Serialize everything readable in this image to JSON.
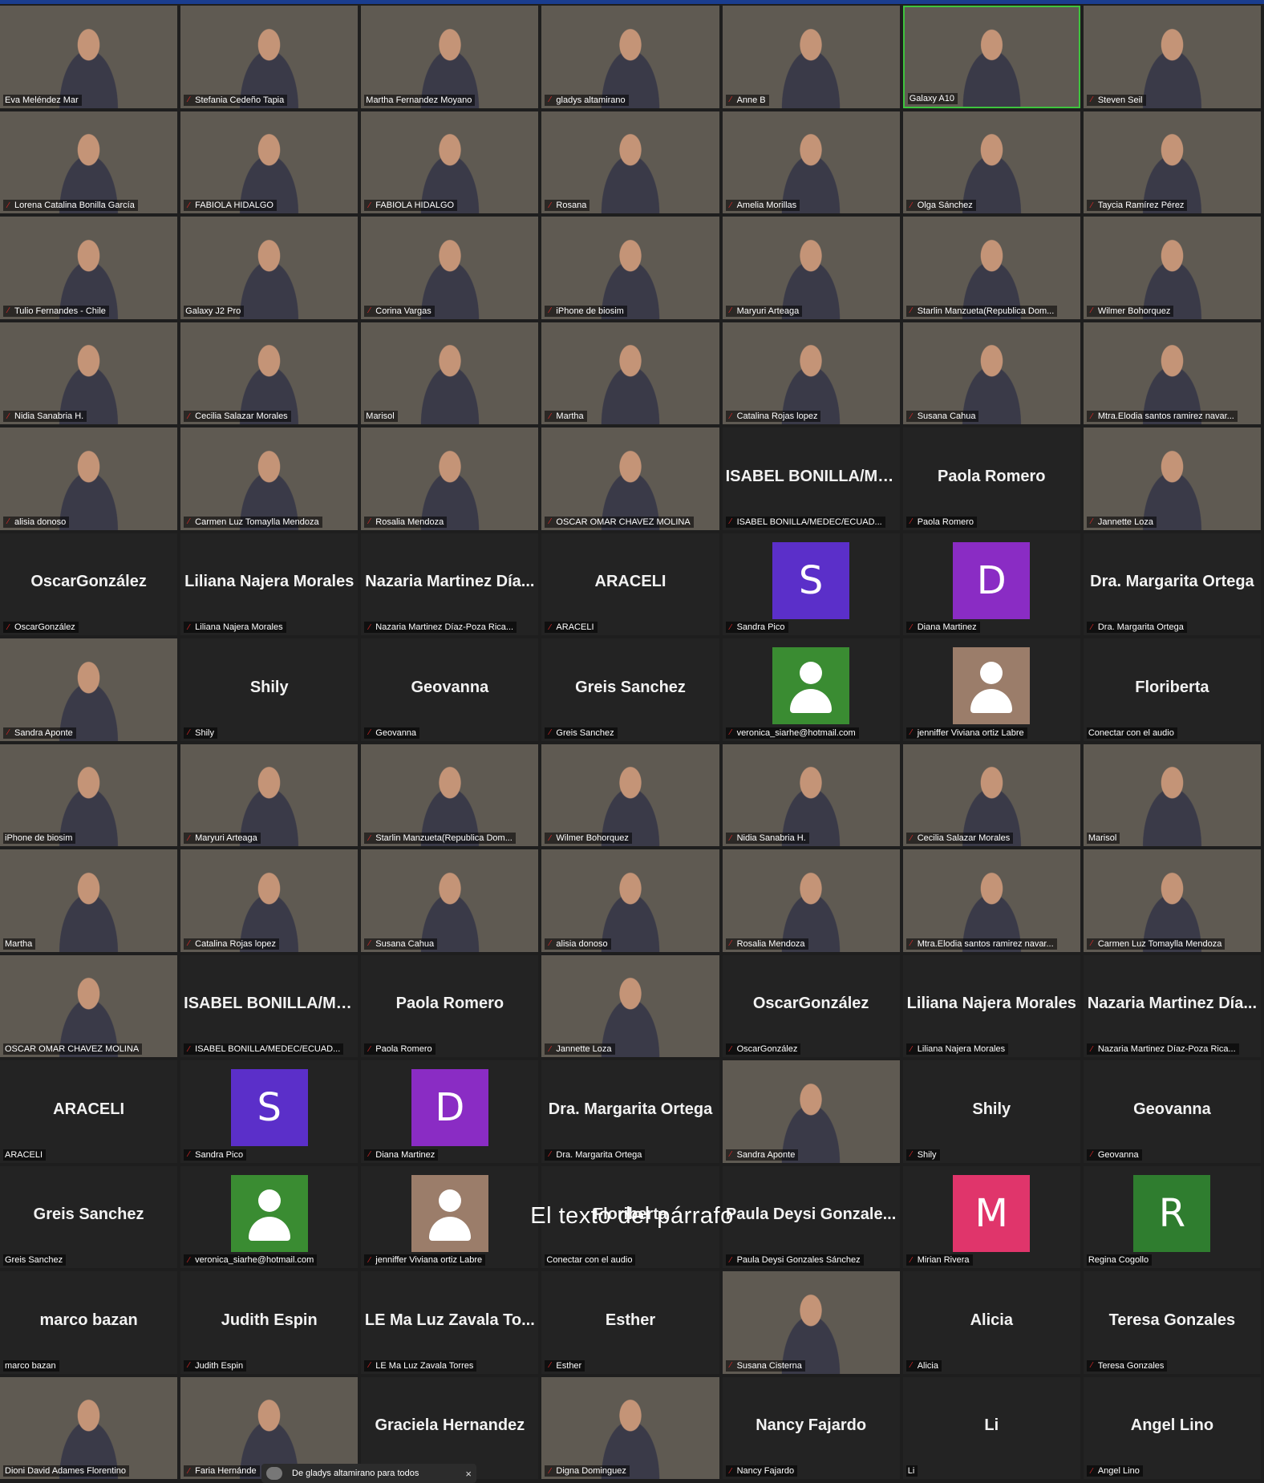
{
  "overlay_text": "El texto del párrafo",
  "chat_toast": {
    "text": "De gladys altamirano para todos",
    "close": "×"
  },
  "colors": {
    "active_speaker_border": "#3ec43e",
    "muted_mic": "#e02828"
  },
  "participants": [
    {
      "label": "Eva Meléndez Mar",
      "video": true
    },
    {
      "label": "Stefania Cedeño Tapia",
      "video": true,
      "muted": true
    },
    {
      "label": "Martha Fernandez Moyano",
      "video": true
    },
    {
      "label": "gladys altamirano",
      "video": true,
      "muted": true
    },
    {
      "label": "Anne B",
      "video": true,
      "muted": true
    },
    {
      "label": "Galaxy A10",
      "video": true,
      "active": true
    },
    {
      "label": "Steven Seil",
      "video": true,
      "muted": true
    },
    {
      "label": "Lorena Catalina Bonilla García",
      "video": true,
      "muted": true
    },
    {
      "label": "FABIOLA HIDALGO",
      "video": true,
      "muted": true
    },
    {
      "label": "FABIOLA HIDALGO",
      "video": true,
      "muted": true
    },
    {
      "label": "Rosana",
      "video": true,
      "muted": true
    },
    {
      "label": "Amelia Morillas",
      "video": true,
      "muted": true
    },
    {
      "label": "Olga Sánchez",
      "video": true,
      "muted": true
    },
    {
      "label": "Taycia Ramírez Pérez",
      "video": true,
      "muted": true
    },
    {
      "label": "Tulio Fernandes - Chile",
      "video": true,
      "muted": true
    },
    {
      "label": "Galaxy J2 Pro",
      "video": true
    },
    {
      "label": "Corina Vargas",
      "video": true,
      "muted": true
    },
    {
      "label": "iPhone de biosim",
      "video": true,
      "muted": true
    },
    {
      "label": "Maryuri Arteaga",
      "video": true,
      "muted": true
    },
    {
      "label": "Starlin Manzueta(Republica Dom...",
      "video": true,
      "muted": true
    },
    {
      "label": "Wilmer Bohorquez",
      "video": true,
      "muted": true
    },
    {
      "label": "Nidia Sanabria H.",
      "video": true,
      "muted": true
    },
    {
      "label": "Cecilia Salazar Morales",
      "video": true,
      "muted": true
    },
    {
      "label": "Marisol",
      "video": true
    },
    {
      "label": "Martha",
      "video": true,
      "muted": true
    },
    {
      "label": "Catalina Rojas lopez",
      "video": true,
      "muted": true
    },
    {
      "label": "Susana Cahua",
      "video": true,
      "muted": true
    },
    {
      "label": "Mtra.Elodia santos ramirez navar...",
      "video": true,
      "muted": true
    },
    {
      "label": "alisia donoso",
      "video": true,
      "muted": true
    },
    {
      "label": "Carmen Luz Tomaylla Mendoza",
      "video": true,
      "muted": true
    },
    {
      "label": "Rosalia Mendoza",
      "video": true,
      "muted": true
    },
    {
      "label": "OSCAR OMAR CHAVEZ MOLINA",
      "video": true,
      "muted": true
    },
    {
      "label": "ISABEL BONILLA/MEDEC/ECUAD...",
      "big": "ISABEL BONILLA/ME...",
      "muted": true
    },
    {
      "label": "Paola Romero",
      "big": "Paola Romero",
      "muted": true
    },
    {
      "label": "Jannette Loza",
      "video": true,
      "muted": true
    },
    {
      "label": "OscarGonzález",
      "big": "OscarGonzález",
      "muted": true
    },
    {
      "label": "Liliana Najera Morales",
      "big": "Liliana Najera Morales",
      "muted": true
    },
    {
      "label": "Nazaria Martinez Díaz-Poza Rica...",
      "big": "Nazaria Martinez Día...",
      "muted": true
    },
    {
      "label": "ARACELI",
      "big": "ARACELI",
      "muted": true
    },
    {
      "label": "Sandra Pico",
      "avatar": "S",
      "avatar_color": "#5b2fc9",
      "muted": true
    },
    {
      "label": "Diana Martinez",
      "avatar": "D",
      "avatar_color": "#8a2cc4",
      "muted": true
    },
    {
      "label": "Dra. Margarita Ortega",
      "big": "Dra. Margarita Ortega",
      "muted": true
    },
    {
      "label": "Sandra Aponte",
      "video": true,
      "muted": true
    },
    {
      "label": "Shily",
      "big": "Shily",
      "muted": true
    },
    {
      "label": "Geovanna",
      "big": "Geovanna",
      "muted": true
    },
    {
      "label": "Greis Sanchez",
      "big": "Greis Sanchez",
      "muted": true
    },
    {
      "label": "veronica_siarhe@hotmail.com",
      "avatar": "person",
      "avatar_color": "#3a8c32",
      "muted": true
    },
    {
      "label": "jenniffer Viviana ortiz Labre",
      "avatar": "person",
      "avatar_color": "#9b7d6a",
      "muted": true
    },
    {
      "label": "Conectar con el audio",
      "big": "Floriberta"
    },
    {
      "label": "iPhone de biosim",
      "video": true
    },
    {
      "label": "Maryuri Arteaga",
      "video": true,
      "muted": true
    },
    {
      "label": "Starlin Manzueta(Republica Dom...",
      "video": true,
      "muted": true
    },
    {
      "label": "Wilmer Bohorquez",
      "video": true,
      "muted": true
    },
    {
      "label": "Nidia Sanabria H.",
      "video": true,
      "muted": true
    },
    {
      "label": "Cecilia Salazar Morales",
      "video": true,
      "muted": true
    },
    {
      "label": "Marisol",
      "video": true
    },
    {
      "label": "Martha",
      "video": true
    },
    {
      "label": "Catalina Rojas lopez",
      "video": true,
      "muted": true
    },
    {
      "label": "Susana Cahua",
      "video": true,
      "muted": true
    },
    {
      "label": "alisia donoso",
      "video": true,
      "muted": true
    },
    {
      "label": "Rosalia Mendoza",
      "video": true,
      "muted": true
    },
    {
      "label": "Mtra.Elodia santos ramirez navar...",
      "video": true,
      "muted": true
    },
    {
      "label": "Carmen Luz Tomaylla Mendoza",
      "video": true,
      "muted": true
    },
    {
      "label": "OSCAR OMAR CHAVEZ MOLINA",
      "video": true
    },
    {
      "label": "ISABEL BONILLA/MEDEC/ECUAD...",
      "big": "ISABEL BONILLA/ME...",
      "muted": true
    },
    {
      "label": "Paola Romero",
      "big": "Paola Romero",
      "muted": true
    },
    {
      "label": "Jannette Loza",
      "video": true,
      "muted": true
    },
    {
      "label": "OscarGonzález",
      "big": "OscarGonzález",
      "muted": true
    },
    {
      "label": "Liliana Najera Morales",
      "big": "Liliana Najera Morales",
      "muted": true
    },
    {
      "label": "Nazaria Martinez Díaz-Poza Rica...",
      "big": "Nazaria Martinez Día...",
      "muted": true
    },
    {
      "label": "ARACELI",
      "big": "ARACELI"
    },
    {
      "label": "Sandra Pico",
      "avatar": "S",
      "avatar_color": "#5b2fc9",
      "muted": true
    },
    {
      "label": "Diana Martinez",
      "avatar": "D",
      "avatar_color": "#8a2cc4",
      "muted": true
    },
    {
      "label": "Dra. Margarita Ortega",
      "big": "Dra. Margarita Ortega",
      "muted": true
    },
    {
      "label": "Sandra Aponte",
      "video": true,
      "muted": true
    },
    {
      "label": "Shily",
      "big": "Shily",
      "muted": true
    },
    {
      "label": "Geovanna",
      "big": "Geovanna",
      "muted": true
    },
    {
      "label": "Greis Sanchez",
      "big": "Greis Sanchez"
    },
    {
      "label": "veronica_siarhe@hotmail.com",
      "avatar": "person",
      "avatar_color": "#3a8c32",
      "muted": true
    },
    {
      "label": "jenniffer Viviana ortiz Labre",
      "avatar": "person",
      "avatar_color": "#9b7d6a",
      "muted": true
    },
    {
      "label": "Conectar con el audio",
      "big": "Floriberta"
    },
    {
      "label": "Paula Deysi Gonzales Sánchez",
      "big": "Paula Deysi Gonzale...",
      "muted": true
    },
    {
      "label": "Mirian Rivera",
      "avatar": "M",
      "avatar_color": "#e0356b",
      "muted": true
    },
    {
      "label": "Regina Cogollo",
      "avatar": "R",
      "avatar_color": "#2f7d2f"
    },
    {
      "label": "marco bazan",
      "big": "marco bazan"
    },
    {
      "label": "Judith Espin",
      "big": "Judith Espin",
      "muted": true
    },
    {
      "label": "LE Ma Luz Zavala Torres",
      "big": "LE Ma Luz Zavala To...",
      "muted": true
    },
    {
      "label": "Esther",
      "big": "Esther",
      "muted": true
    },
    {
      "label": "Susana Cisterna",
      "video": true,
      "muted": true
    },
    {
      "label": "Alicia",
      "big": "Alicia",
      "muted": true
    },
    {
      "label": "Teresa Gonzales",
      "big": "Teresa Gonzales",
      "muted": true
    },
    {
      "label": "Dioni David Adames Florentino",
      "video": true
    },
    {
      "label": "Faria Hernánde",
      "video": true,
      "muted": true
    },
    {
      "label": "",
      "big": "Graciela Hernandez"
    },
    {
      "label": "Digna Dominguez",
      "video": true,
      "muted": true
    },
    {
      "label": "Nancy Fajardo",
      "big": "Nancy Fajardo",
      "muted": true
    },
    {
      "label": "Li",
      "big": "Li"
    },
    {
      "label": "Angel Lino",
      "big": "Angel Lino",
      "muted": true
    }
  ]
}
